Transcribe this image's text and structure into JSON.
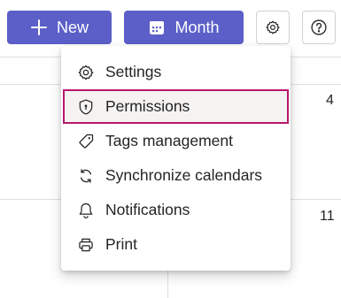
{
  "toolbar": {
    "new_label": "New",
    "month_label": "Month",
    "settings_icon": "gear-icon",
    "help_icon": "question-icon",
    "accent_color": "#5b5fc7"
  },
  "calendar": {
    "day_numbers": [
      "4",
      "11"
    ]
  },
  "menu": {
    "items": [
      {
        "label": "Settings",
        "icon": "gear-icon"
      },
      {
        "label": "Permissions",
        "icon": "shield-icon",
        "selected": true
      },
      {
        "label": "Tags management",
        "icon": "tag-icon"
      },
      {
        "label": "Synchronize calendars",
        "icon": "sync-icon"
      },
      {
        "label": "Notifications",
        "icon": "bell-icon"
      },
      {
        "label": "Print",
        "icon": "printer-icon"
      }
    ],
    "focus_color": "#b8166c"
  }
}
